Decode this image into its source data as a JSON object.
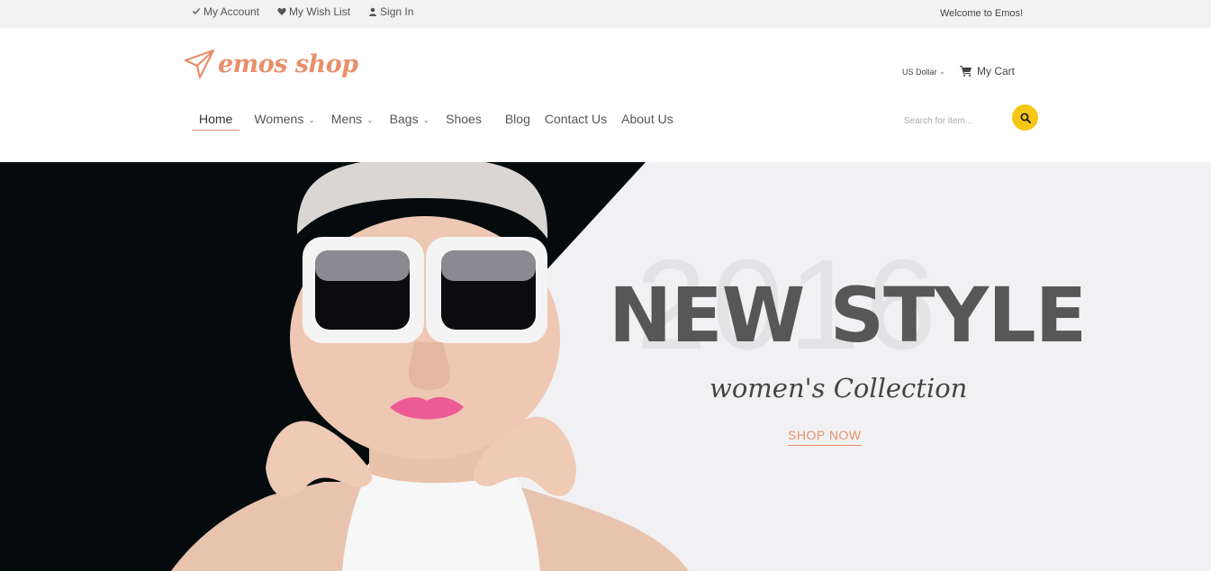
{
  "topbar": {
    "links": [
      {
        "label": "My Account",
        "icon": "check-icon"
      },
      {
        "label": "My Wish List",
        "icon": "heart-icon"
      },
      {
        "label": "Sign In",
        "icon": "user-icon"
      }
    ],
    "welcome": "Welcome to Emos!"
  },
  "header": {
    "logo_text": "emos shop",
    "logo_icon": "paper-plane-icon",
    "currency": "US Dollar",
    "cart_label": "My Cart",
    "search_placeholder": "Search for item..."
  },
  "nav": {
    "items": [
      {
        "label": "Home",
        "active": true,
        "dropdown": false
      },
      {
        "label": "Womens",
        "active": false,
        "dropdown": true
      },
      {
        "label": "Mens",
        "active": false,
        "dropdown": true
      },
      {
        "label": "Bags",
        "active": false,
        "dropdown": true
      },
      {
        "label": "Shoes",
        "active": false,
        "dropdown": false
      },
      {
        "label": "Blog",
        "active": false,
        "dropdown": false
      },
      {
        "label": "Contact Us",
        "active": false,
        "dropdown": false
      },
      {
        "label": "About Us",
        "active": false,
        "dropdown": false
      }
    ]
  },
  "hero": {
    "year": "2016",
    "headline": "NEW STYLE",
    "subline": "women's Collection",
    "cta": "SHOP NOW"
  },
  "colors": {
    "accent": "#e8906a",
    "search_button": "#f7c715",
    "topbar_bg": "#f2f2f2",
    "hero_bg": "#f1f1f3",
    "hero_dark": "#050b0d"
  }
}
